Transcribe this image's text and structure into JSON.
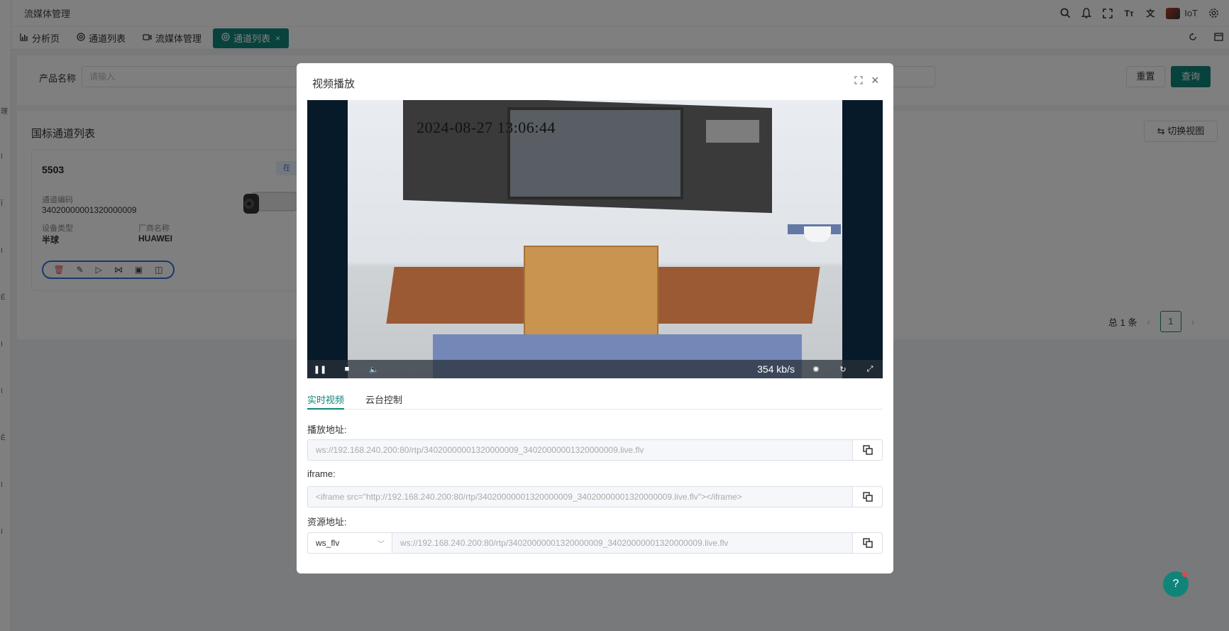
{
  "app": {
    "title": "流媒体管理",
    "brand": "IoT",
    "accent": "#11847a"
  },
  "sidebar_fragments": [
    "理",
    "I",
    "Ĭ",
    "I",
    "Ē",
    "I",
    "I",
    "Ē",
    "I",
    "I",
    "I"
  ],
  "tabs": [
    {
      "label": "分析页",
      "icon": "chart-icon"
    },
    {
      "label": "通道列表",
      "icon": "channel-icon"
    },
    {
      "label": "流媒体管理",
      "icon": "video-icon"
    },
    {
      "label": "通道列表",
      "icon": "channel-icon",
      "active": true
    }
  ],
  "search": {
    "label": "产品名称",
    "placeholder": "请输入",
    "reset_label": "重置",
    "query_label": "查询"
  },
  "list": {
    "title": "国标通道列表",
    "switch_view_label": "切换视图",
    "card": {
      "name": "5503",
      "tag": "在",
      "code_label": "通道编码",
      "code_value": "34020000001320000009",
      "type_label": "设备类型",
      "type_value": "半球",
      "vendor_label": "厂商名称",
      "vendor_value": "HUAWEI"
    },
    "pager": {
      "total": "总 1 条",
      "page": "1"
    }
  },
  "modal": {
    "title": "视频播放",
    "video": {
      "timestamp": "2024-08-27  13:06:44",
      "bitrate": "354 kb/s"
    },
    "tabs": [
      "实时视频",
      "云台控制"
    ],
    "play_url_label": "播放地址:",
    "play_url": "ws://192.168.240.200:80/rtp/34020000001320000009_34020000001320000009.live.flv",
    "iframe_label": "iframe:",
    "iframe_value": "<iframe src=\"http://192.168.240.200:80/rtp/34020000001320000009_34020000001320000009.live.flv\"></iframe>",
    "resource_label": "资源地址:",
    "resource_format": "ws_flv",
    "resource_url": "ws://192.168.240.200:80/rtp/34020000001320000009_34020000001320000009.live.flv"
  }
}
